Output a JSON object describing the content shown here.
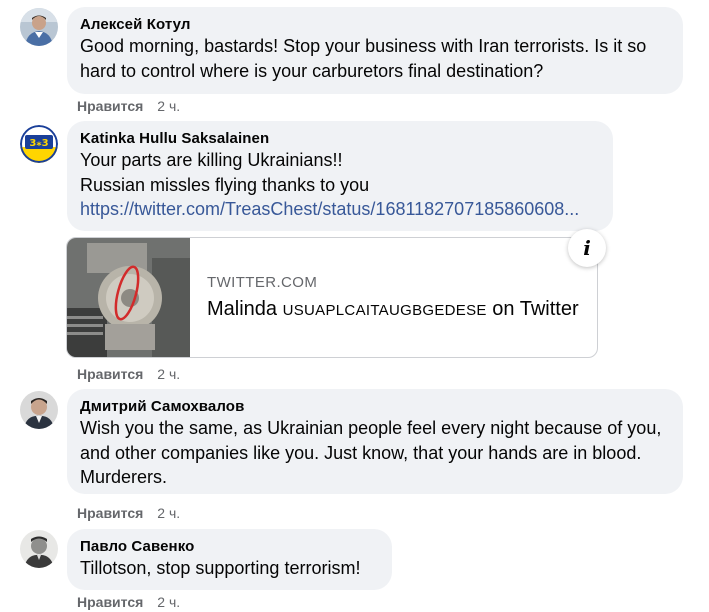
{
  "comments": [
    {
      "author": "Алексей Котул",
      "text": "Good morning, bastards! Stop your business with Iran terrorists. Is it so hard to control where is your carburetors final destination?",
      "like_label": "Нравится",
      "time": "2 ч."
    },
    {
      "author": "Katinka Hullu Saksalainen",
      "text": "Your parts are killing Ukrainians!!\nRussian missles flying thanks to you",
      "link": "https://twitter.com/TreasChest/status/1681182707185860608...",
      "preview": {
        "domain": "TWITTER.COM",
        "title_prefix": "Malinda ",
        "title_caps": "USUAPLCAITAUGBGEDESE",
        "title_suffix": " on Twitter",
        "info_glyph": "i"
      },
      "like_label": "Нравится",
      "time": "2 ч."
    },
    {
      "author": "Дмитрий Самохвалов",
      "text": "Wish you the same, as Ukrainian people feel every night because of you, and other companies like you. Just know, that your hands are in blood. Murderers.",
      "like_label": "Нравится",
      "time": "2 ч."
    },
    {
      "author": "Павло Савенко",
      "text": "Tillotson, stop supporting terrorism!",
      "like_label": "Нравится",
      "time": "2 ч."
    }
  ],
  "icons": {
    "avatar_1": "person-photo-icon",
    "avatar_2": "eu-ukraine-flag-badge-icon",
    "avatar_3": "person-photo-icon",
    "avatar_4": "person-photo-icon",
    "info": "info-icon"
  },
  "colors": {
    "bubble_bg": "#f0f2f5",
    "link": "#385898",
    "meta_text": "#65676b"
  }
}
